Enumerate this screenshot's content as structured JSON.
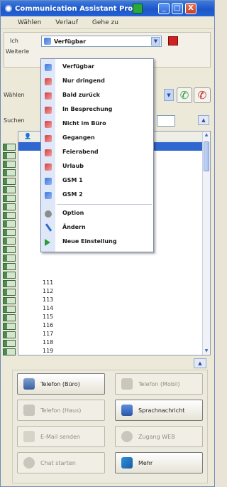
{
  "window": {
    "title": "Communication Assistant Pro",
    "minimize": "_",
    "maximize": "□",
    "close": "X"
  },
  "menubar": {
    "items": [
      "Wählen",
      "Verlauf",
      "Gehe zu"
    ]
  },
  "status_row": {
    "label": "Ich",
    "label2": "Weiterle",
    "selected": "Verfügbar",
    "arrow": "▼"
  },
  "dial_row": {
    "label": "Wählen",
    "arrow": "▼",
    "call": "✆",
    "hangup": "✆"
  },
  "search_row": {
    "label": "Suchen",
    "toggle": "▲"
  },
  "contact_list": {
    "header_icon": "person-icon",
    "numbers": [
      "111",
      "112",
      "113",
      "114",
      "115",
      "116",
      "117",
      "118",
      "119"
    ],
    "scroll_up": "▲",
    "scroll_down": "▼"
  },
  "collapse_toggle": "▲",
  "status_menu": {
    "items": [
      {
        "label": "Verfügbar",
        "icon": "status-available-icon"
      },
      {
        "label": "Nur dringend",
        "icon": "status-urgent-icon"
      },
      {
        "label": "Bald zurück",
        "icon": "status-back-soon-icon"
      },
      {
        "label": "In Besprechung",
        "icon": "status-meeting-icon"
      },
      {
        "label": "Nicht im Büro",
        "icon": "status-out-of-office-icon"
      },
      {
        "label": "Gegangen",
        "icon": "status-gone-icon"
      },
      {
        "label": "Feierabend",
        "icon": "status-off-work-icon"
      },
      {
        "label": "Urlaub",
        "icon": "status-vacation-icon"
      },
      {
        "label": "GSM 1",
        "icon": "status-gsm-icon"
      },
      {
        "label": "GSM 2",
        "icon": "status-gsm-icon"
      },
      {
        "label": "Option",
        "icon": "gear-icon"
      },
      {
        "label": "Ändern",
        "icon": "pencil-icon"
      },
      {
        "label": "Neue Einstellung",
        "icon": "play-icon"
      }
    ]
  },
  "actions": [
    {
      "label": "Telefon (Büro)",
      "icon": "desk-phone-icon",
      "enabled": true
    },
    {
      "label": "Telefon (Mobil)",
      "icon": "mobile-phone-icon",
      "enabled": false
    },
    {
      "label": "Telefon (Haus)",
      "icon": "home-phone-icon",
      "enabled": false
    },
    {
      "label": "Sprachnachricht",
      "icon": "voicemail-icon",
      "enabled": true
    },
    {
      "label": "E-Mail senden",
      "icon": "email-icon",
      "enabled": false
    },
    {
      "label": "Zugang WEB",
      "icon": "web-access-icon",
      "enabled": false
    },
    {
      "label": "Chat starten",
      "icon": "chat-icon",
      "enabled": false
    },
    {
      "label": "Mehr",
      "icon": "more-icon",
      "enabled": true
    }
  ],
  "colors": {
    "titlebar": "#1d56c6",
    "selection": "#2f66d0",
    "call_green": "#2a9a37",
    "hangup_red": "#c6201c"
  }
}
